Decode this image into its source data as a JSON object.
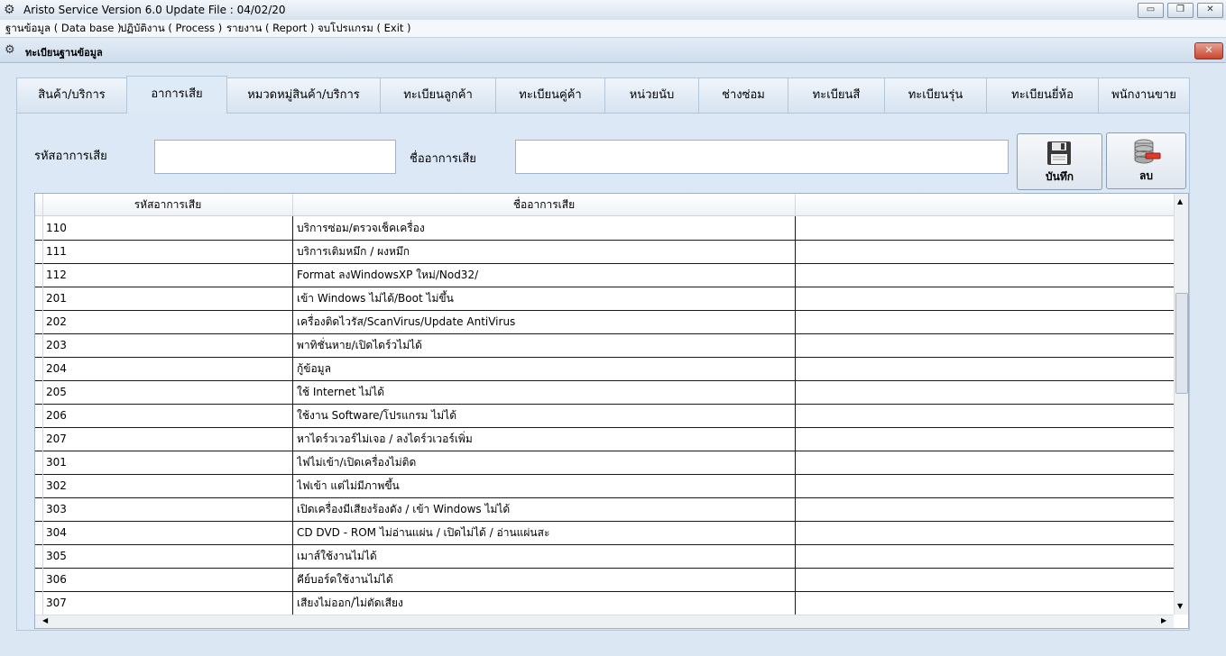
{
  "window": {
    "title": "Aristo Service Version 6.0 Update File : 04/02/20",
    "controls": {
      "minimize": "▭",
      "restore": "❐",
      "close": "✕"
    }
  },
  "menu": [
    "ฐานข้อมูล ( Data base )",
    "ปฏิบัติงาน ( Process )",
    "รายงาน ( Report )",
    "จบโปรแกรม ( Exit )"
  ],
  "child_window": {
    "title": "ทะเบียนฐานข้อมูล",
    "close": "✕"
  },
  "tabs": [
    "สินค้า/บริการ",
    "อาการเสีย",
    "หมวดหมู่สินค้า/บริการ",
    "ทะเบียนลูกค้า",
    "ทะเบียนคู่ค้า",
    "หน่วยนับ",
    "ช่างซ่อม",
    "ทะเบียนสี",
    "ทะเบียนรุ่น",
    "ทะเบียนยี่ห้อ",
    "พนักงานขาย"
  ],
  "active_tab": 1,
  "form": {
    "code_label": "รหัสอาการเสีย",
    "code_value": "",
    "name_label": "ชื่ออาการเสีย",
    "name_value": "",
    "save_button": "บันทึก",
    "delete_button": "ลบ"
  },
  "table": {
    "columns": [
      "รหัสอาการเสีย",
      "ชื่ออาการเสีย"
    ],
    "rows": [
      [
        "110",
        "บริการซ่อม/ตรวจเช็คเครื่อง"
      ],
      [
        "111",
        "บริการเติมหมึก / ผงหมึก"
      ],
      [
        "112",
        "Format ลงWindowsXP ใหม่/Nod32/"
      ],
      [
        "201",
        "เข้า Windows ไม่ได้/Boot ไม่ขึ้น"
      ],
      [
        "202",
        "เครื่องติดไวรัส/ScanVirus/Update AntiVirus"
      ],
      [
        "203",
        "พาทิชั่นหาย/เปิดไดร์วไม่ได้"
      ],
      [
        "204",
        "กู้ข้อมูล"
      ],
      [
        "205",
        "ใช้ Internet ไม่ได้"
      ],
      [
        "206",
        "ใช้งาน Software/โปรแกรม ไม่ได้"
      ],
      [
        "207",
        "หาไดร์วเวอร์ไม่เจอ / ลงไดร์วเวอร์เพิ่ม"
      ],
      [
        "301",
        "ไฟไม่เข้า/เปิดเครื่องไม่ติด"
      ],
      [
        "302",
        "ไฟเข้า แต่ไม่มีภาพขึ้น"
      ],
      [
        "303",
        "เปิดเครื่องมีเสียงร้องดัง / เข้า Windows ไม่ได้"
      ],
      [
        "304",
        "CD DVD - ROM ไม่อ่านแผ่น / เปิดไม่ได้ / อ่านแผ่นสะ"
      ],
      [
        "305",
        "เมาส์ใช้งานไม่ได้"
      ],
      [
        "306",
        "คีย์บอร์ดใช้งานไม่ได้"
      ],
      [
        "307",
        "เสียงไม่ออก/ไม่ตัดเสียง"
      ]
    ]
  },
  "icons": {
    "app": "gear-icon",
    "save": "floppy-disk-icon",
    "delete": "database-delete-icon"
  }
}
